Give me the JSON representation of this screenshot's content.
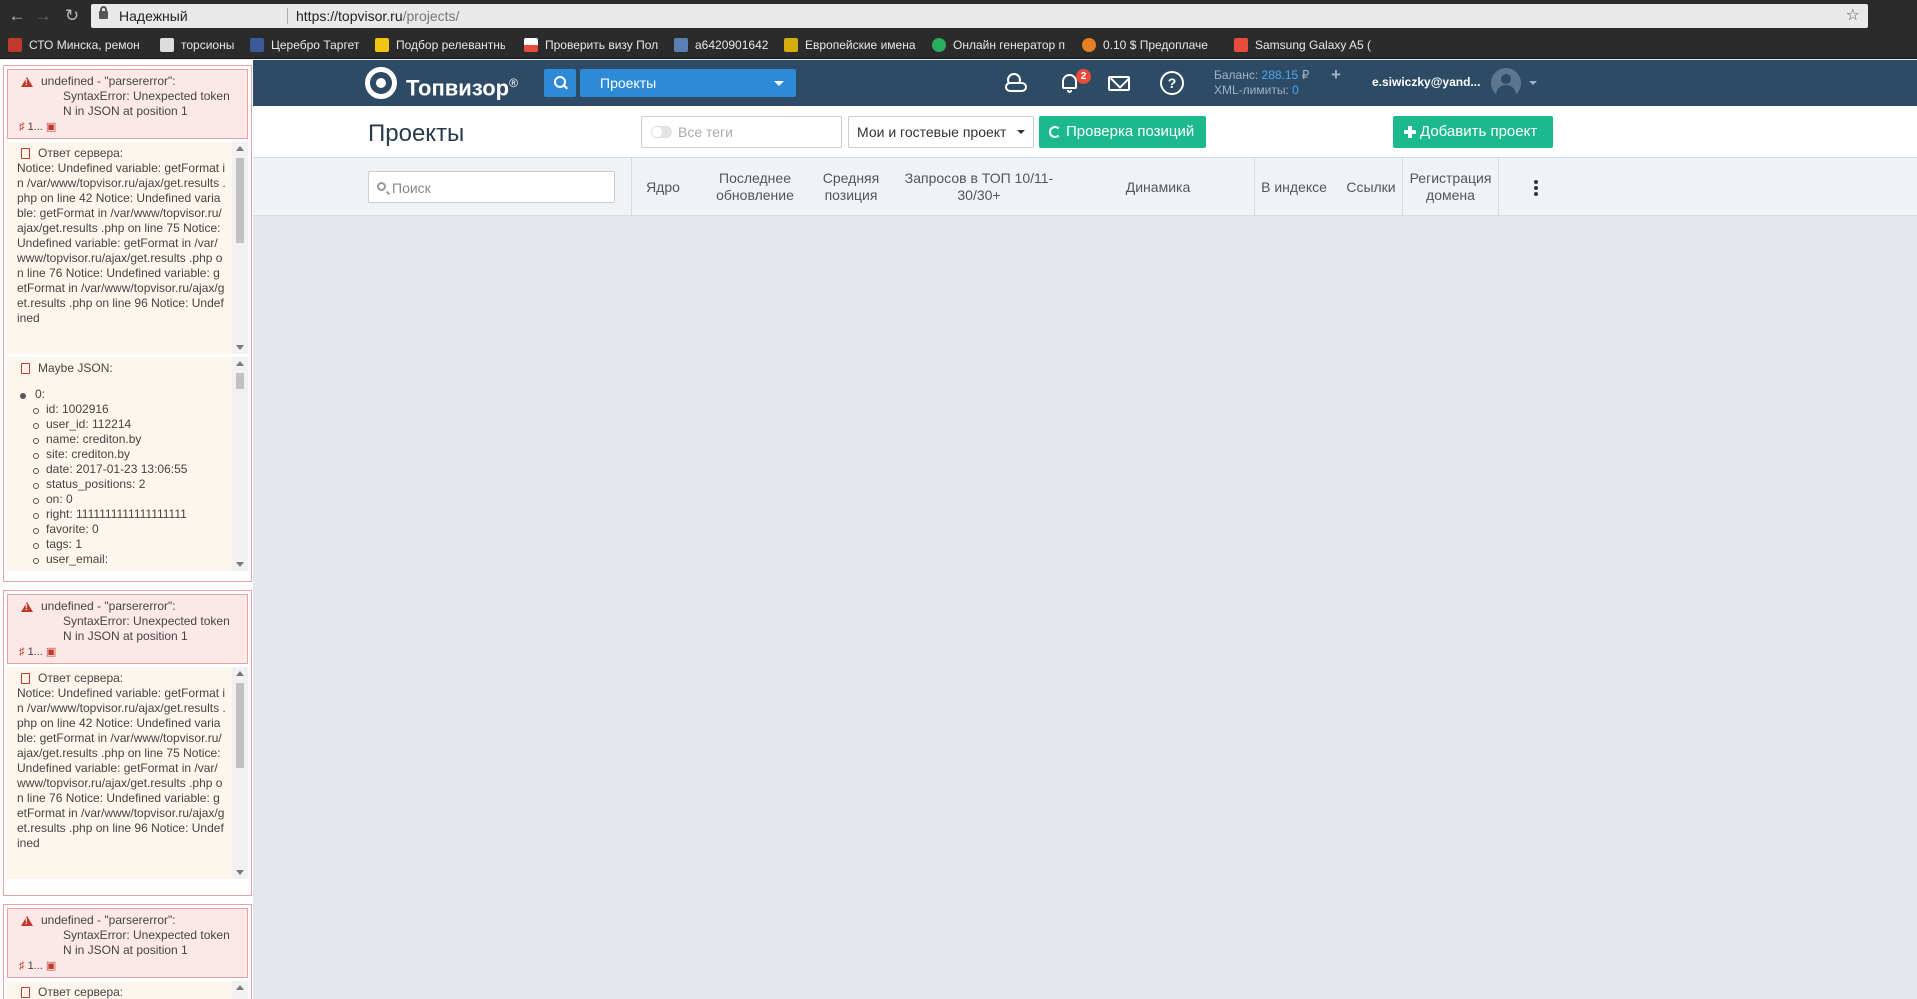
{
  "browser": {
    "secure_label": "Надежный",
    "url_host": "https://topvisor.ru",
    "url_path": "/projects/",
    "bookmarks": [
      {
        "label": "СТО Минска, ремон",
        "color": "#c0392b"
      },
      {
        "label": "торсионы",
        "color": "#dddddd"
      },
      {
        "label": "Церебро Таргет",
        "color": "#3b5998"
      },
      {
        "label": "Подбор релевантны",
        "color": "#f1c40f"
      },
      {
        "label": "Проверить визу Пол",
        "color": "#e74c3c"
      },
      {
        "label": "a6420901642",
        "color": "#5b7fb5"
      },
      {
        "label": "Европейские имена",
        "color": "#d4ac0d"
      },
      {
        "label": "Онлайн генератор п",
        "color": "#27ae60"
      },
      {
        "label": "0.10 $ Предоплаче",
        "color": "#e67e22"
      },
      {
        "label": "Samsung Galaxy A5 (",
        "color": "#e74c3c"
      }
    ]
  },
  "debug": {
    "errors": [
      {
        "message": "undefined - \"parsererror\": SyntaxError: Unexpected token N in JSON at position 1",
        "footer": "1..."
      },
      {
        "message": "undefined - \"parsererror\": SyntaxError: Unexpected token N in JSON at position 1",
        "footer": "1..."
      },
      {
        "message": "undefined - \"parsererror\": SyntaxError: Unexpected token N in JSON at position 1",
        "footer": "1..."
      }
    ],
    "server_response_label": "Ответ сервера:",
    "server_response_text": "Notice: Undefined variable: getFormat in /var/www/topvisor.ru/ajax/get.results .php on line 42 Notice: Undefined variable: getFormat in /var/www/topvisor.ru/ajax/get.results .php on line 75 Notice: Undefined variable: getFormat in /var/www/topvisor.ru/ajax/get.results .php on line 76 Notice: Undefined variable: getFormat in /var/www/topvisor.ru/ajax/get.results .php on line 96 Notice: Undefined",
    "maybe_json_label": "Maybe JSON:",
    "json_root": "0:",
    "json_fields": [
      "id: 1002916",
      "user_id: 112214",
      "name: crediton.by",
      "site: crediton.by",
      "date: 2017-01-23 13:06:55",
      "status_positions: 2",
      "on: 0",
      "right: 1111111111111111111",
      "favorite: 0",
      "tags: 1",
      "user_email:"
    ]
  },
  "header": {
    "brand": "Топвизор",
    "brand_mark": "®",
    "project_select": "Проекты",
    "notifications_count": "2",
    "balance_label": "Баланс:",
    "balance_value": "288.15",
    "currency": "₽",
    "xml_label": "XML-лимиты:",
    "xml_value": "0",
    "user_email": "e.siwiczky@yand..."
  },
  "toolbar": {
    "page_title": "Проекты",
    "tags_placeholder": "Все теги",
    "owner_select": "Мои и гостевые проект",
    "check_label": "Проверка позиций",
    "add_label": "Добавить проект"
  },
  "table": {
    "search_placeholder": "Поиск",
    "columns": [
      "Ядро",
      "Последнее обновление",
      "Средняя позиция",
      "Запросов в ТОП 10/11-30/30+",
      "Динамика",
      "В индексе",
      "Ссылки",
      "Регистрация домена"
    ]
  }
}
